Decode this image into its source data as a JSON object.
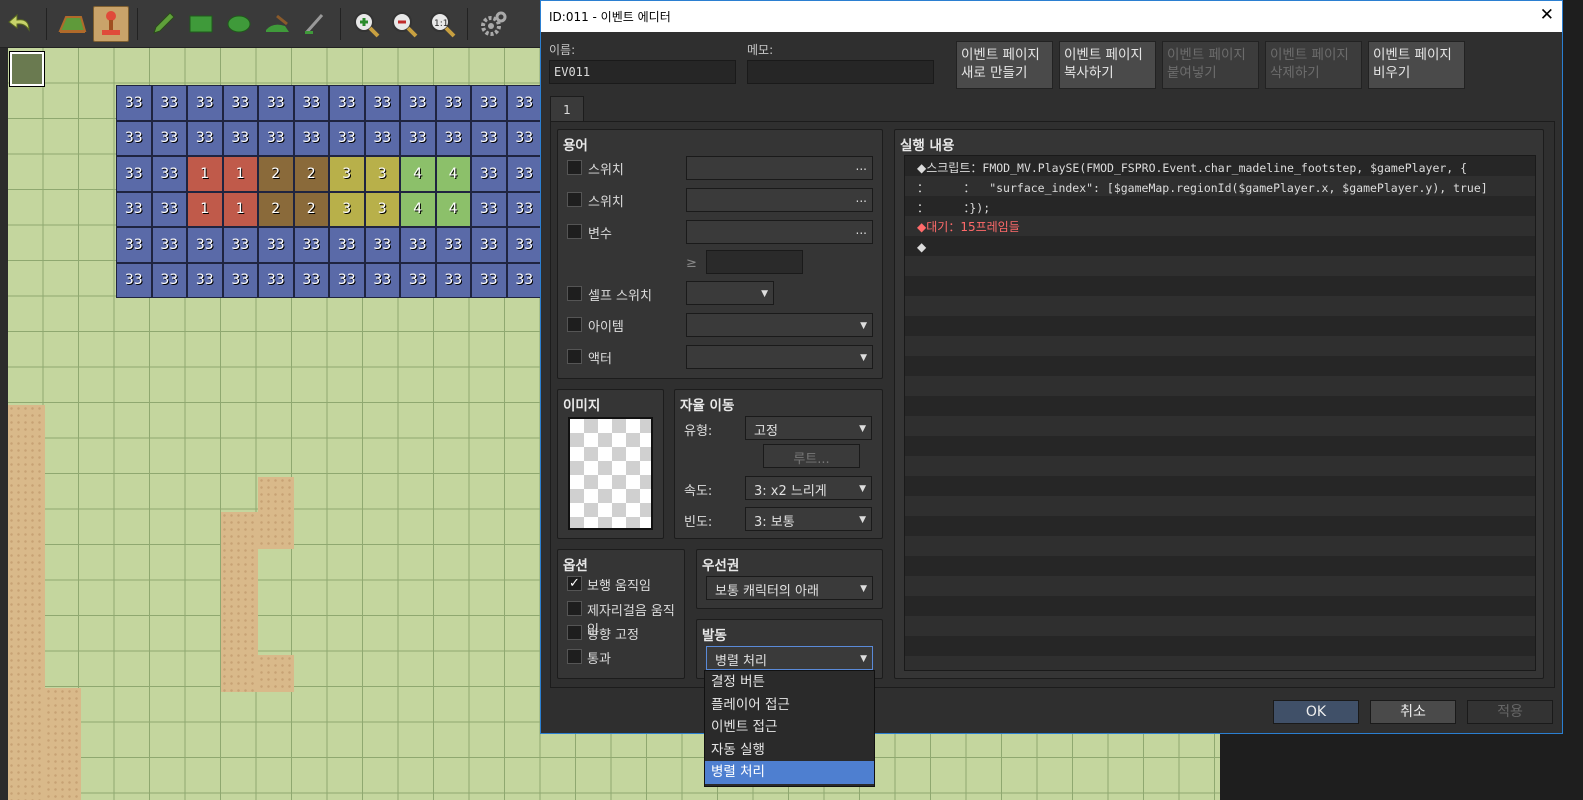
{
  "toolbar": {
    "icons": [
      "undo-icon",
      "map-mode-icon",
      "event-mode-icon",
      "pencil-icon",
      "rectangle-icon",
      "ellipse-icon",
      "fill-icon",
      "shadow-pen-icon",
      "zoom-in-icon",
      "zoom-out-icon",
      "actual-size-icon",
      "settings-icon"
    ],
    "active": "event-mode-icon"
  },
  "map": {
    "region_rows": [
      [
        "33",
        "33",
        "33",
        "33",
        "33",
        "33",
        "33",
        "33",
        "33",
        "33",
        "33",
        "33"
      ],
      [
        "33",
        "33",
        "33",
        "33",
        "33",
        "33",
        "33",
        "33",
        "33",
        "33",
        "33",
        "33"
      ],
      [
        "33",
        "33",
        "1",
        "1",
        "2",
        "2",
        "3",
        "3",
        "4",
        "4",
        "33",
        "33"
      ],
      [
        "33",
        "33",
        "1",
        "1",
        "2",
        "2",
        "3",
        "3",
        "4",
        "4",
        "33",
        "33"
      ],
      [
        "33",
        "33",
        "33",
        "33",
        "33",
        "33",
        "33",
        "33",
        "33",
        "33",
        "33",
        "33"
      ],
      [
        "33",
        "33",
        "33",
        "33",
        "33",
        "33",
        "33",
        "33",
        "33",
        "33",
        "33",
        "33"
      ]
    ],
    "region_colors": {
      "33": "#5a6aa8",
      "1": "#c05a4a",
      "2": "#8a6a3a",
      "3": "#b8b04a",
      "4": "#8cc06a"
    }
  },
  "dialog": {
    "title": "ID:011 - 이벤트 에디터",
    "close_glyph": "✕",
    "name_label": "이름:",
    "name_value": "EV011",
    "memo_label": "메모:",
    "memo_value": "",
    "page_buttons": {
      "new": "이벤트 페이지\n새로 만들기",
      "copy": "이벤트 페이지\n복사하기",
      "paste": "이벤트 페이지\n붙여넣기",
      "delete": "이벤트 페이지\n삭제하기",
      "clear": "이벤트 페이지\n비우기"
    },
    "tab": "1",
    "conditions": {
      "title": "용어",
      "switch1": "스위치",
      "switch2": "스위치",
      "variable": "변수",
      "ge": "≥",
      "self_switch": "셀프 스위치",
      "item": "아이템",
      "actor": "액터",
      "dots": "..."
    },
    "image": {
      "title": "이미지"
    },
    "autonomous": {
      "title": "자율 이동",
      "type_label": "유형:",
      "type_value": "고정",
      "route_button": "루트...",
      "speed_label": "속도:",
      "speed_value": "3: x2 느리게",
      "freq_label": "빈도:",
      "freq_value": "3: 보통"
    },
    "options": {
      "title": "옵션",
      "walking": "보행 움직임",
      "stepping": "제자리걸음 움직임",
      "direction_fix": "방향 고정",
      "through": "통과"
    },
    "priority": {
      "title": "우선권",
      "value": "보통 캐릭터의 아래"
    },
    "trigger": {
      "title": "발동",
      "value": "병렬 처리",
      "options": [
        "결정 버튼",
        "플레이어 접근",
        "이벤트 접근",
        "자동 실행",
        "병렬 처리"
      ],
      "selected_index": 4
    },
    "contents": {
      "title": "실행 내용",
      "lines": [
        {
          "prefix": "◆스크립트",
          "sep": "：",
          "body": "FMOD_MV.PlaySE(FMOD_FSPRO.Event.char_madeline_footstep, $gamePlayer, {"
        },
        {
          "prefix": "：",
          "sep": "         ：",
          "body": "  \"surface_index\": [$gameMap.regionId($gamePlayer.x, $gamePlayer.y), true]"
        },
        {
          "prefix": "：",
          "sep": "         ：",
          "body": "});"
        },
        {
          "prefix": "◆대기",
          "sep": "：",
          "body": "15프레임들"
        },
        {
          "prefix": "◆",
          "sep": "",
          "body": ""
        }
      ],
      "wait_color": "#ff6a6a"
    },
    "ok": "OK",
    "cancel": "취소",
    "apply": "적용"
  }
}
